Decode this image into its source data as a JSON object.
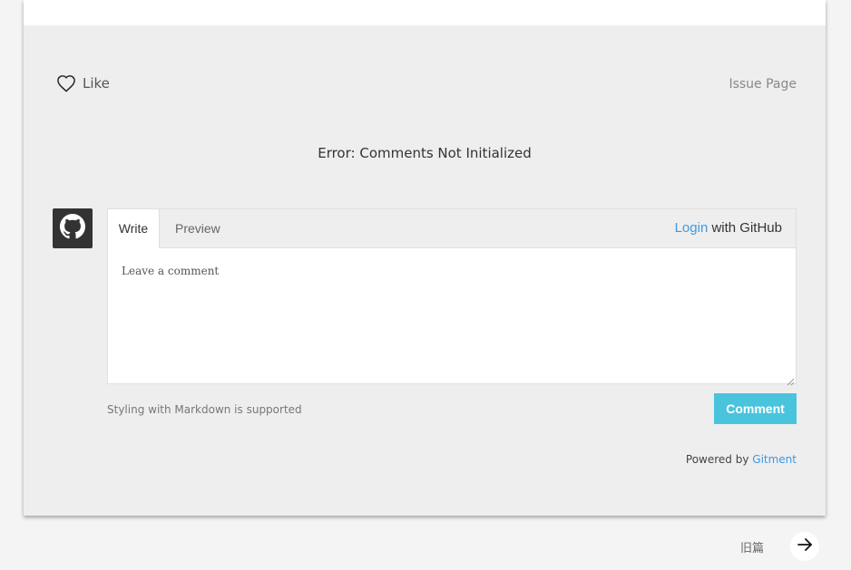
{
  "like": {
    "label": "Like",
    "icon": "heart-outline-icon"
  },
  "issue_page": {
    "label": "Issue Page"
  },
  "error": {
    "message": "Error: Comments Not Initialized"
  },
  "avatar": {
    "icon": "github-icon"
  },
  "editor": {
    "tabs": [
      {
        "label": "Write",
        "active": true
      },
      {
        "label": "Preview",
        "active": false
      }
    ],
    "login_link": "Login",
    "login_suffix": " with GitHub",
    "placeholder": "Leave a comment"
  },
  "footer": {
    "markdown_note": "Styling with Markdown is supported",
    "comment_button": "Comment",
    "powered_prefix": "Powered by ",
    "powered_link": "Gitment"
  },
  "pagination": {
    "older_label": "旧篇",
    "arrow_icon": "arrow-right-icon"
  },
  "colors": {
    "accent": "#3b9ae4",
    "button": "#4ac4dd",
    "card_bg": "#eeeeee",
    "avatar_bg": "#333333"
  }
}
